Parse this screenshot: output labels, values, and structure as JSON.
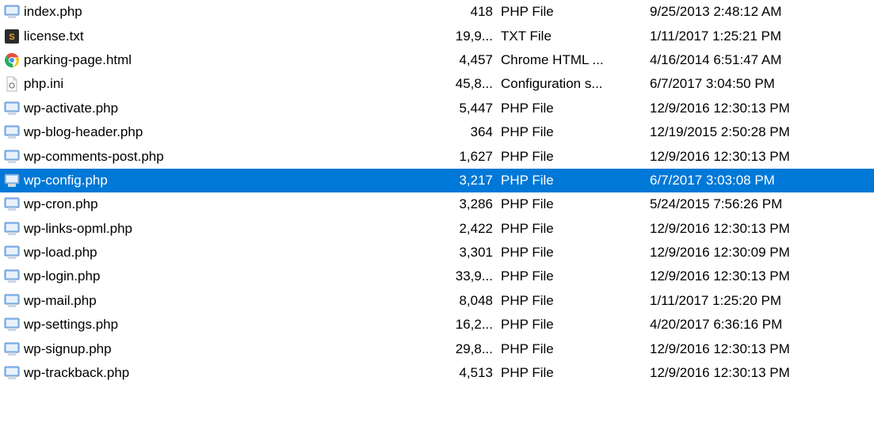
{
  "files": [
    {
      "name": "index.php",
      "size": "418",
      "type": "PHP File",
      "modified": "9/25/2013 2:48:12 AM",
      "icon": "php",
      "selected": false
    },
    {
      "name": "license.txt",
      "size": "19,9...",
      "type": "TXT File",
      "modified": "1/11/2017 1:25:21 PM",
      "icon": "txt",
      "selected": false
    },
    {
      "name": "parking-page.html",
      "size": "4,457",
      "type": "Chrome HTML ...",
      "modified": "4/16/2014 6:51:47 AM",
      "icon": "chrome",
      "selected": false
    },
    {
      "name": "php.ini",
      "size": "45,8...",
      "type": "Configuration s...",
      "modified": "6/7/2017 3:04:50 PM",
      "icon": "ini",
      "selected": false
    },
    {
      "name": "wp-activate.php",
      "size": "5,447",
      "type": "PHP File",
      "modified": "12/9/2016 12:30:13 PM",
      "icon": "php",
      "selected": false
    },
    {
      "name": "wp-blog-header.php",
      "size": "364",
      "type": "PHP File",
      "modified": "12/19/2015 2:50:28 PM",
      "icon": "php",
      "selected": false
    },
    {
      "name": "wp-comments-post.php",
      "size": "1,627",
      "type": "PHP File",
      "modified": "12/9/2016 12:30:13 PM",
      "icon": "php",
      "selected": false
    },
    {
      "name": "wp-config.php",
      "size": "3,217",
      "type": "PHP File",
      "modified": "6/7/2017 3:03:08 PM",
      "icon": "php",
      "selected": true
    },
    {
      "name": "wp-cron.php",
      "size": "3,286",
      "type": "PHP File",
      "modified": "5/24/2015 7:56:26 PM",
      "icon": "php",
      "selected": false
    },
    {
      "name": "wp-links-opml.php",
      "size": "2,422",
      "type": "PHP File",
      "modified": "12/9/2016 12:30:13 PM",
      "icon": "php",
      "selected": false
    },
    {
      "name": "wp-load.php",
      "size": "3,301",
      "type": "PHP File",
      "modified": "12/9/2016 12:30:09 PM",
      "icon": "php",
      "selected": false
    },
    {
      "name": "wp-login.php",
      "size": "33,9...",
      "type": "PHP File",
      "modified": "12/9/2016 12:30:13 PM",
      "icon": "php",
      "selected": false
    },
    {
      "name": "wp-mail.php",
      "size": "8,048",
      "type": "PHP File",
      "modified": "1/11/2017 1:25:20 PM",
      "icon": "php",
      "selected": false
    },
    {
      "name": "wp-settings.php",
      "size": "16,2...",
      "type": "PHP File",
      "modified": "4/20/2017 6:36:16 PM",
      "icon": "php",
      "selected": false
    },
    {
      "name": "wp-signup.php",
      "size": "29,8...",
      "type": "PHP File",
      "modified": "12/9/2016 12:30:13 PM",
      "icon": "php",
      "selected": false
    },
    {
      "name": "wp-trackback.php",
      "size": "4,513",
      "type": "PHP File",
      "modified": "12/9/2016 12:30:13 PM",
      "icon": "php",
      "selected": false
    }
  ]
}
